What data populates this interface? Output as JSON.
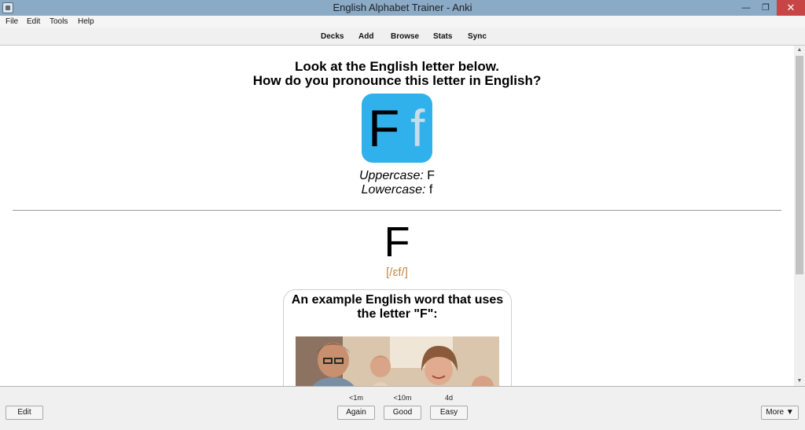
{
  "window": {
    "title": "English Alphabet Trainer - Anki",
    "minimize_glyph": "—",
    "restore_glyph": "❐",
    "close_glyph": "✕"
  },
  "menu": {
    "file": "File",
    "edit": "Edit",
    "tools": "Tools",
    "help": "Help"
  },
  "toolbar": {
    "decks": "Decks",
    "add": "Add",
    "browse": "Browse",
    "stats": "Stats",
    "sync": "Sync"
  },
  "card": {
    "question_line1": "Look at the English letter below.",
    "question_line2": "How do you pronounce this letter in English?",
    "tile_upper": "F",
    "tile_lower": "f",
    "tile_color": "#31b1ec",
    "uppercase_label": "Uppercase:",
    "uppercase_value": "F",
    "lowercase_label": "Lowercase:",
    "lowercase_value": "f",
    "answer_letter": "F",
    "pronunciation": "[/ɛf/]",
    "example_line1": "An example English word that uses",
    "example_line2": "the letter \"F\":"
  },
  "bottom": {
    "edit": "Edit",
    "again_interval": "<1m",
    "good_interval": "<10m",
    "easy_interval": "4d",
    "again": "Again",
    "good": "Good",
    "easy": "Easy",
    "more": "More ▼"
  },
  "scrollbar": {
    "up_glyph": "▲",
    "down_glyph": "▼"
  }
}
